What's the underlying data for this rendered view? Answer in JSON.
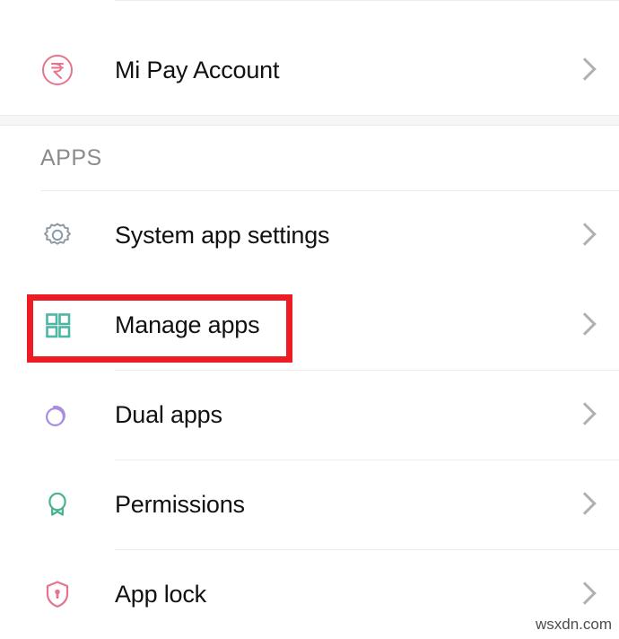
{
  "screen": {
    "title": "Settings — Apps section",
    "background": "#ffffff"
  },
  "top_section": {
    "rows": [
      {
        "id": "mi-pay-account",
        "label": "Mi Pay Account",
        "icon": "rupee-circle-icon",
        "icon_color": "#e8738c",
        "chevron": "chevron-right-icon",
        "has_top_divider": true
      }
    ]
  },
  "apps_section": {
    "header": "APPS",
    "header_color": "#8c8c8c",
    "rows": [
      {
        "id": "system-app-settings",
        "label": "System app settings",
        "icon": "gear-icon",
        "icon_color": "#8c9aa5",
        "chevron": "chevron-right-icon"
      },
      {
        "id": "manage-apps",
        "label": "Manage apps",
        "icon": "grid-squares-icon",
        "icon_color": "#4db6a4",
        "chevron": "chevron-right-icon",
        "highlighted": true
      },
      {
        "id": "dual-apps",
        "label": "Dual apps",
        "icon": "overlapping-circles-icon",
        "icon_color": "#a88ce0",
        "chevron": "chevron-right-icon"
      },
      {
        "id": "permissions",
        "label": "Permissions",
        "icon": "award-ribbon-icon",
        "icon_color": "#44b38f",
        "chevron": "chevron-right-icon"
      },
      {
        "id": "app-lock",
        "label": "App lock",
        "icon": "shield-lock-icon",
        "icon_color": "#e8738c",
        "chevron": "chevron-right-icon"
      }
    ]
  },
  "annotation": {
    "highlight_color": "#ed1c24",
    "highlight_target": "manage-apps"
  },
  "watermark": {
    "text": "wsxdn.com"
  }
}
